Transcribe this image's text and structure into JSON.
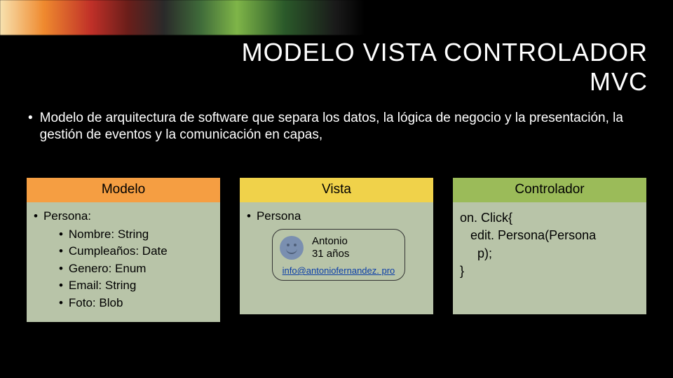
{
  "title_line1": "MODELO VISTA CONTROLADOR",
  "title_line2": "MVC",
  "description": "Modelo de arquitectura de software que separa los datos, la lógica de negocio y la presentación, la gestión de eventos y la comunicación en capas,",
  "columns": {
    "modelo": {
      "header": "Modelo",
      "title": "Persona:",
      "fields": [
        "Nombre: String",
        "Cumpleaños: Date",
        "Genero: Enum",
        "Email: String",
        "Foto: Blob"
      ]
    },
    "vista": {
      "header": "Vista",
      "title": "Persona",
      "card": {
        "line1": "Antonio",
        "line2": "31 años",
        "link": "info@antoniofernandez. pro"
      }
    },
    "controlador": {
      "header": "Controlador",
      "code": "on. Click{\n   edit. Persona(Persona\n     p);\n}"
    }
  }
}
